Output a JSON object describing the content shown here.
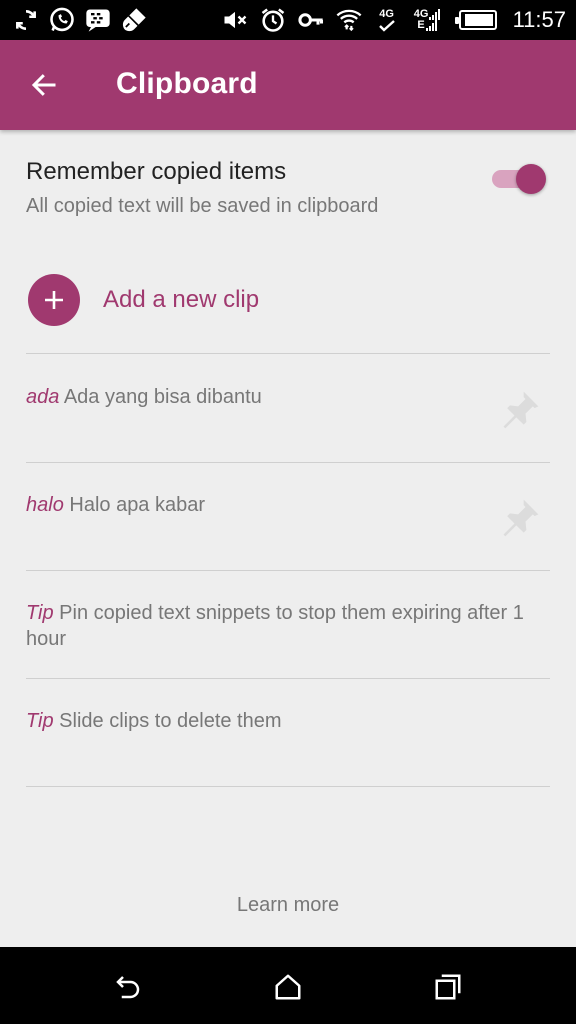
{
  "status_bar": {
    "time": "11:57",
    "net_top": "4G",
    "net2_top": "4G",
    "net2_bottom": "E"
  },
  "app_bar": {
    "title": "Clipboard"
  },
  "settings": {
    "remember_title": "Remember copied items",
    "remember_subtitle": "All copied text will be saved in clipboard",
    "remember_enabled": true
  },
  "add_clip": {
    "label": "Add a new clip"
  },
  "clips": [
    {
      "key": "ada",
      "text": "Ada yang bisa dibantu",
      "pinnable": true
    },
    {
      "key": "halo",
      "text": "Halo apa kabar",
      "pinnable": true
    },
    {
      "key": "Tip",
      "text": "Pin copied text snippets to stop them expiring after 1 hour",
      "pinnable": false
    },
    {
      "key": "Tip",
      "text": "Slide clips to delete them",
      "pinnable": false
    }
  ],
  "footer": {
    "learn_more": "Learn more"
  },
  "colors": {
    "accent": "#a0396f",
    "toggle_track": "#d9a3bf"
  }
}
